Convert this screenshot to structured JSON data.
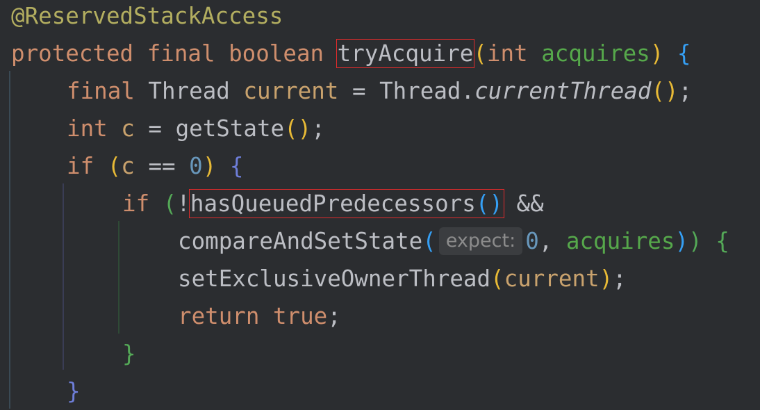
{
  "code": {
    "annotation": "@ReservedStackAccess",
    "kw_protected": "protected",
    "kw_final": "final",
    "kw_boolean": "boolean",
    "method_name": "tryAcquire",
    "kw_int": "int",
    "param_acquires": "acquires",
    "type_thread": "Thread",
    "var_current": "current",
    "thread_class": "Thread",
    "current_thread_method": "currentThread",
    "var_c": "c",
    "get_state": "getState",
    "kw_if": "if",
    "zero": "0",
    "has_queued": "hasQueuedPredecessors",
    "and_op": "&&",
    "cas_method": "compareAndSetState",
    "hint_expect": "expect:",
    "set_owner": "setExclusiveOwnerThread",
    "kw_return": "return",
    "kw_true": "true"
  },
  "colors": {
    "background": "#2b2d30",
    "keyword": "#cf8e6d",
    "annotation": "#b3ae60",
    "parameter": "#56a84b",
    "highlight_border": "#e22b2b"
  }
}
